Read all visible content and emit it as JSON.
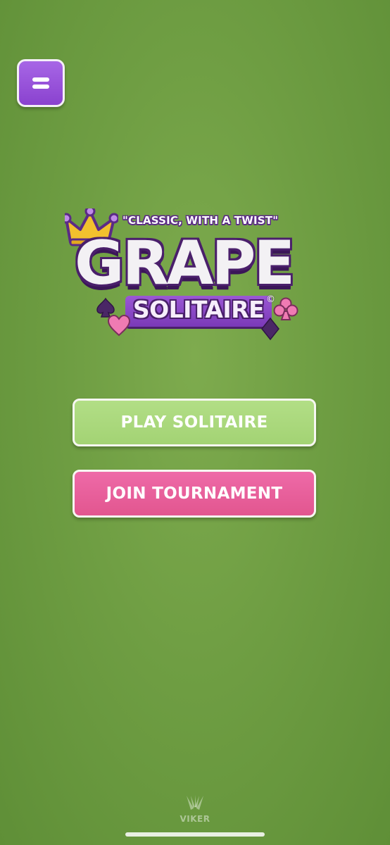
{
  "menu": {
    "icon": "menu-icon"
  },
  "logo": {
    "tagline": "\"CLASSIC, WITH A TWIST\"",
    "title": "GRAPE",
    "subtitle": "SOLITAIRE",
    "trademark": "©",
    "crown_color": "#f2c12e",
    "suit_icons": [
      "spade-icon",
      "heart-icon",
      "club-icon",
      "diamond-icon"
    ]
  },
  "buttons": {
    "play_label": "PLAY SOLITAIRE",
    "play_color": "#a9d77c",
    "join_label": "JOIN TOURNAMENT",
    "join_color": "#e8609b"
  },
  "footer": {
    "brand": "VIKER"
  },
  "colors": {
    "felt": "#6f9e43",
    "menu": "#9c55dd",
    "brand_purple": "#7a39b8"
  }
}
